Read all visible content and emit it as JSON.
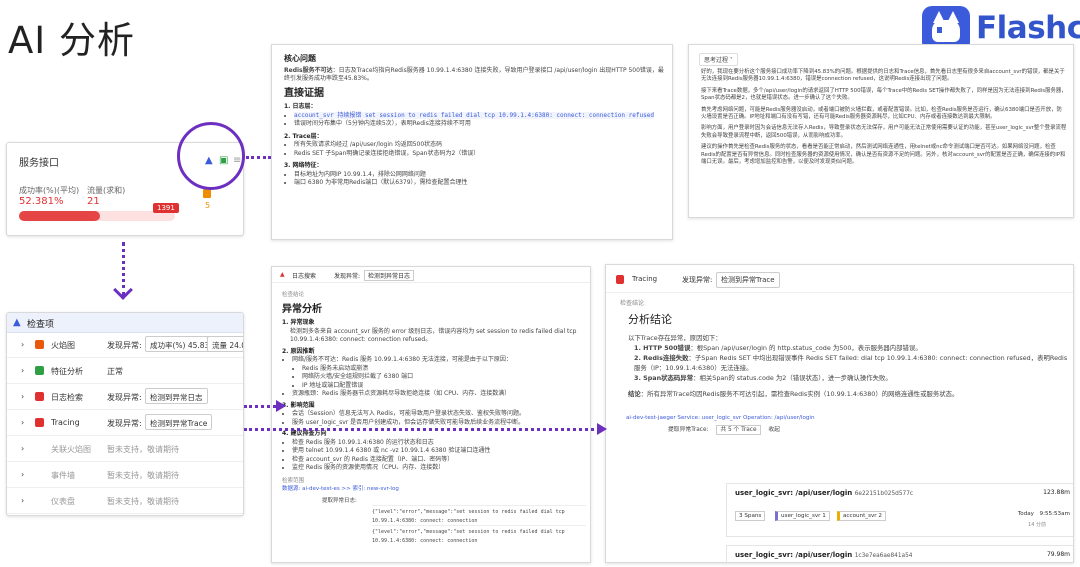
{
  "slide": {
    "title": "AI 分析",
    "logo_text": "Flashcat"
  },
  "service_card": {
    "title": "服务接口",
    "success_rate_label": "成功率(%)(平均)",
    "success_rate_value": "52.381%",
    "traffic_label": "流量(求和)",
    "traffic_value": "21",
    "badge": "1391",
    "alert_count": "5",
    "success_fraction": 0.52
  },
  "checklist": {
    "title": "检查项",
    "rows": [
      {
        "name": "火焰图",
        "key": "发现异常:",
        "chips": [
          "成功率(%) 45.83",
          "流量 24.00"
        ],
        "icon_color": "#e8590c",
        "dim": false
      },
      {
        "name": "特征分析",
        "key": "正常",
        "chips": [],
        "icon_color": "#2f9e44",
        "dim": false
      },
      {
        "name": "日志检索",
        "key": "发现异常:",
        "chips": [
          "检测到异常日志"
        ],
        "icon_color": "#e03131",
        "dim": false
      },
      {
        "name": "Tracing",
        "key": "发现异常:",
        "chips": [
          "检测到异常Trace"
        ],
        "icon_color": "#e03131",
        "dim": false
      },
      {
        "name": "关联火焰图",
        "key": "暂未支持，敬请期待",
        "chips": [],
        "icon_color": "",
        "dim": true
      },
      {
        "name": "事件墙",
        "key": "暂未支持，敬请期待",
        "chips": [],
        "icon_color": "",
        "dim": true
      },
      {
        "name": "仪表盘",
        "key": "暂未支持，敬请期待",
        "chips": [],
        "icon_color": "",
        "dim": true
      }
    ]
  },
  "core": {
    "heading": "核心问题",
    "summary_bold": "Redis服务不可达",
    "summary": "：日志及Trace均指向Redis服务器 10.99.1.4:6380 连接失败，导致用户登录接口 /api/user/login 出现HTTP 500错误，最终引发服务成功率跌至45.83%。",
    "direct_evidence": "直接证据",
    "logs_title": "1. 日志层：",
    "logs_1": "account_svr 持续报错 set session to redis failed dial tcp 10.99.1.4:6380: connect: connection refused",
    "logs_2": "错误时间分布集中（5分钟内连续5次），表明Redis连接持续不可用",
    "trace_title": "2. Trace层：",
    "trace_1": "所有失败请求均经过 /api/user/login 均返回500状态码",
    "trace_2": "Redis SET 子Span明确记录连接拒绝错误，Span状态码为2（错误）",
    "net_title": "3. 网络特征：",
    "net_1": "目标地址为内网IP 10.99.1.4，排除公网网络问题",
    "net_2": "端口 6380 为非常用Redis端口（默认6379），需检查配置合理性"
  },
  "think": {
    "tag": "思考过程",
    "paragraphs": [
      "好的，我现在要分析这个服务接口成功率下降到45.83%的问题。根据提供的日志和Trace信息，首先看日志里有很多来自account_svr的错误，都是关于无法连接到Redis服务器10.99.1.4:6380，错误是connection refused，这说明Redis连接出现了问题。",
      "接下来看Trace数据，多个/api/user/login的请求返回了HTTP 500错误，每个Trace中的Redis SET操作都失败了，同样是因为无法连接到Redis服务器，Span状态码都是2，也就是错误状态。进一步确认了这个失败。",
      "首先考虑网络问题，可能是Redis服务器没启动，或者端口被防火墙拦截，或者配置错误。比如，检查Redis服务是否运行，确认6380端口是否开放，防火墙设置是否正确。IP地址和端口有没有写错，还有可能Redis服务器资源耗尽，比如CPU、内存或者连接数达到最大限制。",
      "影响方面，用户登录时因为会话信息无法存入Redis，导致登录状态无法保存，用户可能无法正常使用需要认证的功能，甚至user_logic_svr整个登录流程失败会导致登录流程中断，返回500错误，从而影响成功率。",
      "建议的操作首先是检查Redis服务的状态，看看是否能正常启动，然后测试网络连通性，用telnet或nc命令测试端口是否可达。如果网络没问题，检查Redis的配置是否有异常信息。同时检查服务器的资源使用情况，确认是否有资源不足的问题。另外，核对account_svr的配置是否正确，确保连接的IP和端口无误。最后，考虑增加监控和告警，以便及时发现类似问题。"
    ]
  },
  "analysis": {
    "top_a": "日志搜索",
    "top_b": "发现异常:",
    "top_c": "检测到异常日志",
    "breadcrumb": "检查结论",
    "heading": "异常分析",
    "s1_title": "1. 异常现象",
    "s1_text": "检测到多条来自 account_svr 服务的 error 级别日志，错误内容均为 set session to redis failed dial tcp 10.99.1.4:6380: connect: connection refused。",
    "s2_title": "2. 原因推断",
    "s2_a": "网络/服务不可达：Redis 服务 10.99.1.4:6380 无法连接，可能是由于以下原因：",
    "s2_a1": "Redis 服务未启动或崩溃",
    "s2_a2": "网络防火墙/安全组规则拦截了 6380 端口",
    "s2_a3": "IP 地址或端口配置错误",
    "s2_b": "资源瓶颈：Redis 服务器节点资源耗尽导致拒绝连接（如 CPU、内存、连接数满）",
    "s3_title": "3. 影响范围",
    "s3_a": "会话（Session）信息无法写入 Redis，可能导致用户登录状态失效、鉴权失败等问题。",
    "s3_b": "服务 user_logic_svr 是否用户创建成功，但会话存储失败可能导致后续业务流程中断。",
    "s4_title": "4. 建议排查方向",
    "s4_a": "检查 Redis 服务 10.99.1.4:6380 的运行状态和日志",
    "s4_b": "使用 telnet 10.99.1.4 6380 或 nc -vz 10.99.1.4 6380 验证端口连通性",
    "s4_c": "检查 account_svr 的 Redis 连接配置（IP、端口、密码等）",
    "s4_d": "监控 Redis 服务的资源使用情况（CPU、内存、连接数）",
    "footer_label": "检索范围",
    "footer_link": "数据源: ai-dev-test-es >> 索引: new-svr-log",
    "log_label": "提取异常日志:",
    "log_line": "{\"level\":\"error\",\"message\":\"set session to redis failed dial tcp 10.99.1.4:6380: connect: connection"
  },
  "conclusion": {
    "top_a": "Tracing",
    "top_b": "发现异常:",
    "top_c": "检测到异常Trace",
    "breadcrumb": "检查结论",
    "heading": "分析结论",
    "intro": "以下Trace存在异常，原因如下：",
    "p1_bold": "1. HTTP 500错误",
    "p1": "：根Span /api/user/login 的 http.status_code 为500，表示服务器内部错误。",
    "p2_bold": "2. Redis连接失败",
    "p2": "：子Span Redis SET 中均出现错误事件 Redis SET failed: dial tcp 10.99.1.4:6380: connect: connection refused，表明Redis服务（IP：10.99.1.4:6380）无法连接。",
    "p3_bold": "3. Span状态码异常",
    "p3": "：相关Span的 status.code 为2（错误状态），进一步确认操作失败。",
    "conclusion_bold": "结论",
    "conclusion": "：所有异常Trace均因Redis服务不可达引起，需检查Redis实例（10.99.1.4:6380）的网络连通性或服务状态。",
    "source": "ai-dev-test-jaeger Service: user_logic_svr Operation: /api/user/login",
    "extract_label": "提取异常Trace:",
    "extract_count": "共 5 个 Trace",
    "collapse": "收起",
    "trace1_title": "user_logic_svr: /api/user/login",
    "trace1_id": "6e22151b025d577c",
    "trace1_dur": "123.88m",
    "spans": "3 Spans",
    "svc1": "user_logic_svr 1",
    "svc2": "account_svr 2",
    "today": "Today",
    "time": "9:55:53am",
    "ago": "14 分前",
    "trace2_title": "user_logic_svr: /api/user/login",
    "trace2_id": "1c3e7ea6ae841a54",
    "trace2_dur": "79.98m"
  }
}
